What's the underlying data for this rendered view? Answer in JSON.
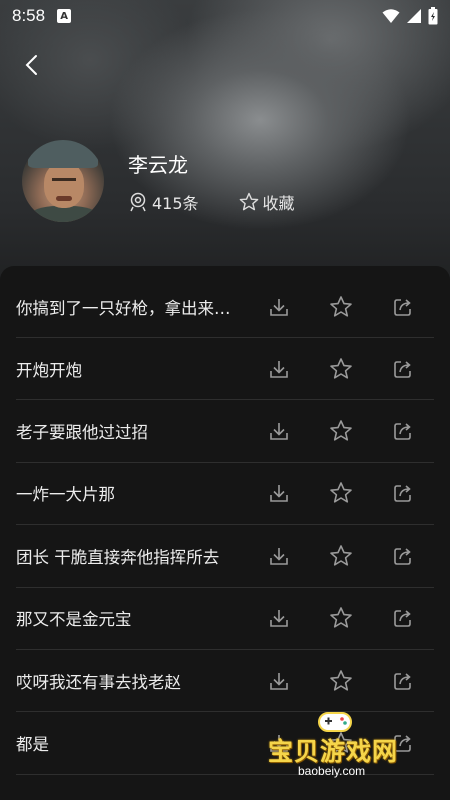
{
  "status": {
    "time": "8:58",
    "notification_letter": "A"
  },
  "profile": {
    "name": "李云龙",
    "count": "415条",
    "favorite_label": "收藏"
  },
  "items": [
    {
      "text": "你搞到了一只好枪，拿出来看看"
    },
    {
      "text": "开炮开炮"
    },
    {
      "text": "老子要跟他过过招"
    },
    {
      "text": "一炸一大片那"
    },
    {
      "text": "团长 干脆直接奔他指挥所去"
    },
    {
      "text": "那又不是金元宝"
    },
    {
      "text": "哎呀我还有事去找老赵"
    },
    {
      "text": "都是"
    }
  ],
  "watermark": {
    "title": "宝贝游戏网",
    "url": "baobeiy.com"
  },
  "colors": {
    "sheet": "#151515",
    "divider": "#2e2e2e",
    "watermark": "#f5d54a"
  }
}
